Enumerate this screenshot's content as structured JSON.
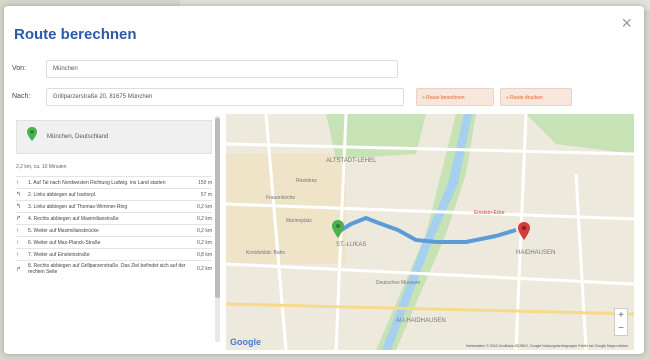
{
  "dialog": {
    "title": "Route berechnen",
    "close_glyph": "×"
  },
  "form": {
    "von_label": "Von:",
    "von_value": "München",
    "nach_label": "Nach:",
    "nach_value": "Grillparzerstraße 20, 81675 München",
    "route_button": "» Route berechnen",
    "print_button": "» Route drucken"
  },
  "directions": {
    "start": "München, Deutschland",
    "summary": "2,2 km, ca. 10 Minuten",
    "steps": [
      {
        "icon": "↑",
        "text": "1. Auf Tal nach Nordwesten Richtung Ludwig. ins Land starten",
        "dist": "150 m"
      },
      {
        "icon": "↰",
        "text": "2. Links abbiegen auf Isartorpl.",
        "dist": "57 m"
      },
      {
        "icon": "↰",
        "text": "3. Links abbiegen auf Thomas-Wimmer-Ring",
        "dist": "0,2 km"
      },
      {
        "icon": "↱",
        "text": "4. Rechts abbiegen auf Maximilianstraße",
        "dist": "0,2 km"
      },
      {
        "icon": "↑",
        "text": "5. Weiter auf Maximiliansbrücke",
        "dist": "0,2 km"
      },
      {
        "icon": "↑",
        "text": "6. Weiter auf Max-Planck-Straße",
        "dist": "0,2 km"
      },
      {
        "icon": "↑",
        "text": "7. Weiter auf Einsteinstraße",
        "dist": "0,8 km"
      },
      {
        "icon": "↱",
        "text": "8. Rechts abbiegen auf Grillparzerstraße. Das Ziel befindet sich auf der rechten Seite",
        "dist": "0,2 km"
      }
    ]
  },
  "map": {
    "brand": "Google",
    "attribution": "Kartendaten © 2016 GeoBasis-DE/BKG, Google   Nutzungsbedingungen   Fehler bei Google Maps melden",
    "labels": [
      {
        "text": "ALTSTADT-LEHEL",
        "key": "altstadt"
      },
      {
        "text": "ST.-LUKAS",
        "key": "lukas"
      },
      {
        "text": "HAIDHAUSEN",
        "key": "haidhausen"
      },
      {
        "text": "AU-HAIDHAUSEN",
        "key": "au"
      },
      {
        "text": "Residenz",
        "key": "residenz"
      },
      {
        "text": "Marienplatz",
        "key": "marienplatz"
      },
      {
        "text": "Frauenkirche",
        "key": "frauenkirche"
      },
      {
        "text": "Deutsches Museum",
        "key": "museum"
      },
      {
        "text": "Kreisfeldstr. Bahn",
        "key": "kreis"
      },
      {
        "text": "Einstein-Ecke",
        "key": "einstein"
      }
    ],
    "zoom_in": "+",
    "zoom_out": "−",
    "colors": {
      "route": "#5b9bd8",
      "river": "#a6d0ee",
      "park": "#c7e2b4",
      "start_pin": "#4caf50",
      "end_pin": "#d33d3d"
    }
  }
}
